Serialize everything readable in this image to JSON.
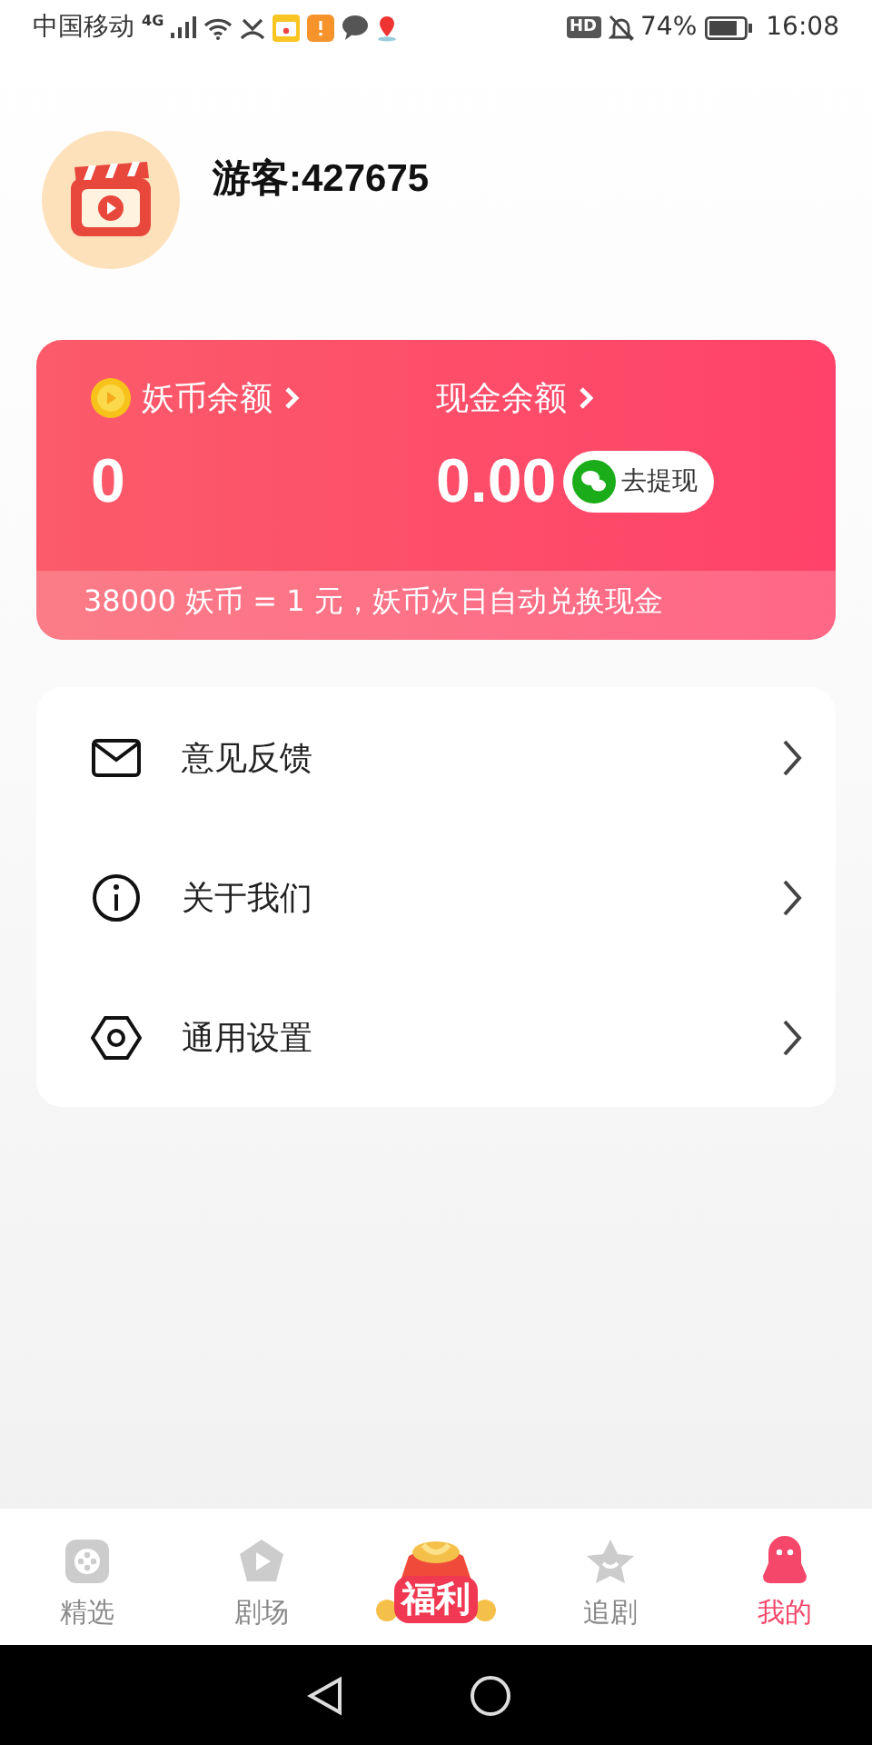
{
  "status_bar": {
    "carrier": "中国移动",
    "network": "4G",
    "hd": "HD",
    "battery": "74%",
    "time": "16:08"
  },
  "profile": {
    "name": "游客:427675"
  },
  "wallet": {
    "coin_label": "妖币余额",
    "coin_value": "0",
    "cash_label": "现金余额",
    "cash_value": "0.00",
    "withdraw_button": "去提现",
    "note": "38000 妖币 = 1 元，妖币次日自动兑换现金"
  },
  "menu": [
    {
      "kind": "mail",
      "label": "意见反馈"
    },
    {
      "kind": "info",
      "label": "关于我们"
    },
    {
      "kind": "settings",
      "label": "通用设置"
    }
  ],
  "tabs": [
    {
      "kind": "film",
      "label": "精选",
      "selected": false
    },
    {
      "kind": "play",
      "label": "剧场",
      "selected": false
    },
    {
      "kind": "bag",
      "label": "福利",
      "selected": false
    },
    {
      "kind": "star",
      "label": "追剧",
      "selected": false
    },
    {
      "kind": "person",
      "label": "我的",
      "selected": true
    }
  ]
}
